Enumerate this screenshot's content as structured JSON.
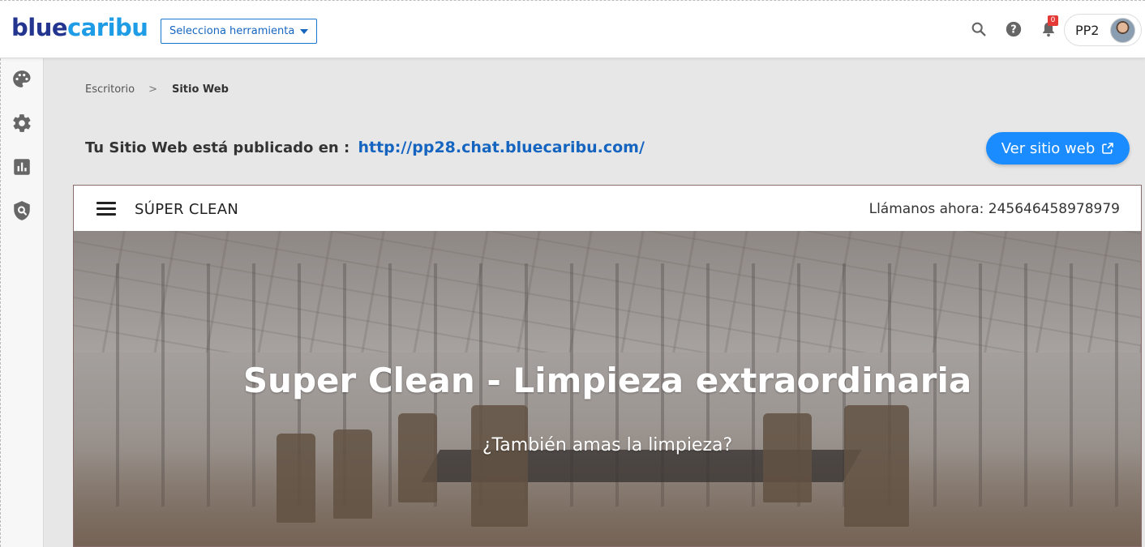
{
  "logo": {
    "part1": "blue",
    "part2": "caribu"
  },
  "tool_select": {
    "label": "Selecciona herramienta"
  },
  "notifications": {
    "count": "0"
  },
  "user": {
    "name": "PP2"
  },
  "breadcrumb": {
    "root": "Escritorio",
    "separator": ">",
    "current": "Sitio Web"
  },
  "published": {
    "text": "Tu Sitio Web está publicado en :",
    "url": "http://pp28.chat.bluecaribu.com/"
  },
  "view_button": {
    "label": "Ver sitio web"
  },
  "preview": {
    "brand": "SÚPER CLEAN",
    "phone": "Llámanos ahora: 245646458978979",
    "hero_title": "Super Clean - Limpieza extraordinaria",
    "hero_subtitle": "¿También amas la limpieza?"
  },
  "icons": {
    "top": [
      "search-icon",
      "help-icon",
      "bell-icon"
    ],
    "sidebar": [
      "palette-icon",
      "gear-icon",
      "bar-chart-icon",
      "shield-search-icon"
    ]
  },
  "colors": {
    "brand_dark": "#23358f",
    "brand_light": "#1f9ce6",
    "accent": "#1a8cff",
    "link": "#1565c0"
  }
}
